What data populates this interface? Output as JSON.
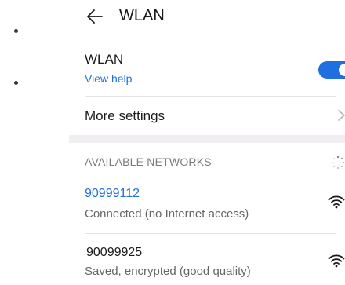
{
  "header": {
    "title": "WLAN",
    "back_icon": "back-arrow-icon"
  },
  "wlan": {
    "label": "WLAN",
    "help_link": "View help",
    "toggle_on": true,
    "accent_color": "#1f6fe0"
  },
  "more_settings": {
    "label": "More settings",
    "chevron_icon": "chevron-right-icon"
  },
  "available_networks": {
    "header": "AVAILABLE NETWORKS",
    "scanning_icon": "loading-spinner-icon",
    "networks": [
      {
        "ssid": "90999112",
        "status": "Connected (no Internet access)",
        "connected": true,
        "icon": "wifi-icon"
      },
      {
        "ssid": "90099925",
        "status": "Saved, encrypted (good quality)",
        "connected": false,
        "icon": "wifi-icon"
      }
    ]
  }
}
